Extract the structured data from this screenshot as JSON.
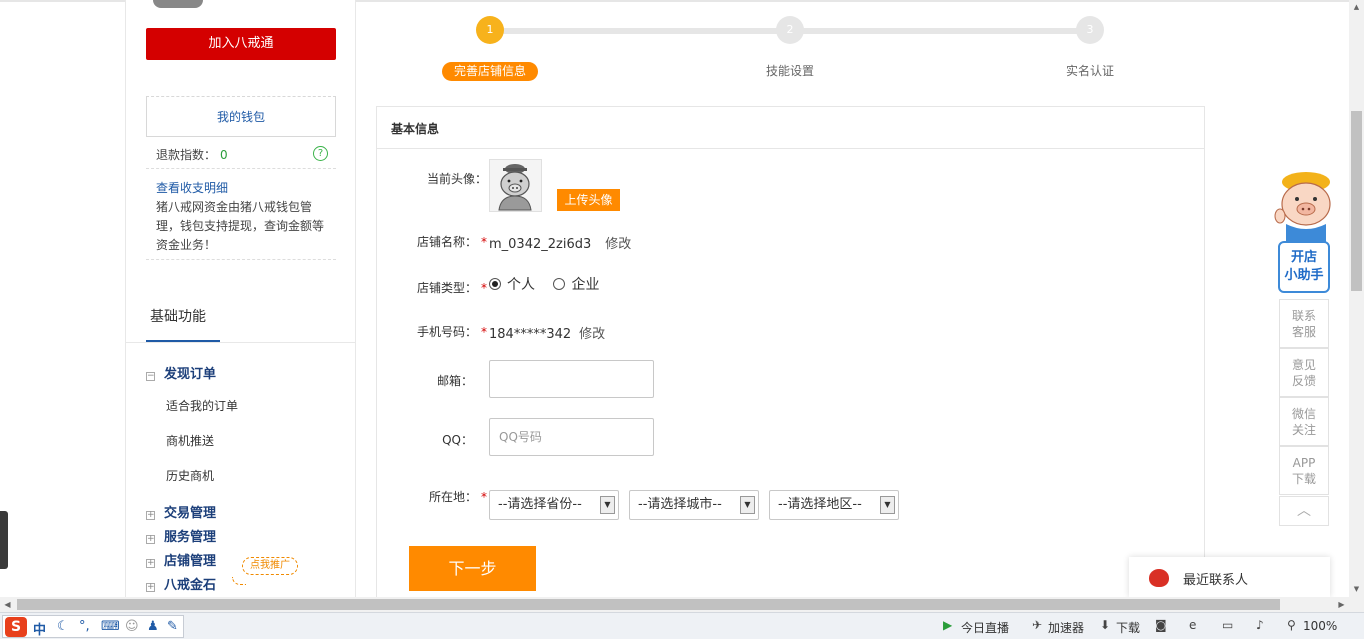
{
  "sidebar": {
    "join_button": "加入八戒通",
    "wallet_label": "我的钱包",
    "refund_label": "退款指数：",
    "refund_value": "0",
    "help_glyph": "?",
    "detail_link": "查看收支明细",
    "wallet_desc": "猪八戒网资金由猪八戒钱包管理，钱包支持提现，查询金额等资金业务！",
    "basic_title": "基础功能",
    "groups": [
      {
        "label": "发现订单",
        "toggle": "−"
      },
      {
        "label": "交易管理",
        "toggle": "+"
      },
      {
        "label": "服务管理",
        "toggle": "+"
      },
      {
        "label": "店铺管理",
        "toggle": "+"
      },
      {
        "label": "八戒金石",
        "toggle": "+"
      }
    ],
    "sub_items": [
      "适合我的订单",
      "商机推送",
      "历史商机"
    ],
    "promo_badge": "点我推广"
  },
  "steps": [
    {
      "num": "1",
      "label": "完善店铺信息",
      "active": true
    },
    {
      "num": "2",
      "label": "技能设置",
      "active": false
    },
    {
      "num": "3",
      "label": "实名认证",
      "active": false
    }
  ],
  "form": {
    "section_title": "基本信息",
    "avatar_label": "当前头像：",
    "upload_button": "上传头像",
    "shop_name_label": "店铺名称：",
    "shop_name_value": "m_0342_2zi6d3",
    "edit_text": "修改",
    "shop_type_label": "店铺类型：",
    "type_personal": "个人",
    "type_company": "企业",
    "phone_label": "手机号码：",
    "phone_value": "184*****342",
    "email_label": "邮箱：",
    "email_value": "",
    "qq_label": "QQ：",
    "qq_placeholder": "QQ号码",
    "location_label": "所在地：",
    "required_mark": "*",
    "province": "--请选择省份--",
    "city": "--请选择城市--",
    "district": "--请选择地区--",
    "next_button": "下一步"
  },
  "helper": {
    "open_line1": "开店",
    "open_line2": "小助手",
    "tabs": [
      {
        "l1": "联系",
        "l2": "客服"
      },
      {
        "l1": "意见",
        "l2": "反馈"
      },
      {
        "l1": "微信",
        "l2": "关注"
      },
      {
        "l1": "APP",
        "l2": "下载"
      }
    ],
    "top_glyph": "︿"
  },
  "recent_contacts": "最近联系人",
  "statusbar": {
    "ime_logo": "S",
    "ime_mode": "中",
    "live": "今日直播",
    "accelerator": "加速器",
    "download": "下载",
    "zoom": "100%"
  },
  "colors": {
    "brand_red": "#d40000",
    "accent_orange": "#ff8a00",
    "step_active": "#f7b21c",
    "link_blue": "#1f5aa6"
  }
}
